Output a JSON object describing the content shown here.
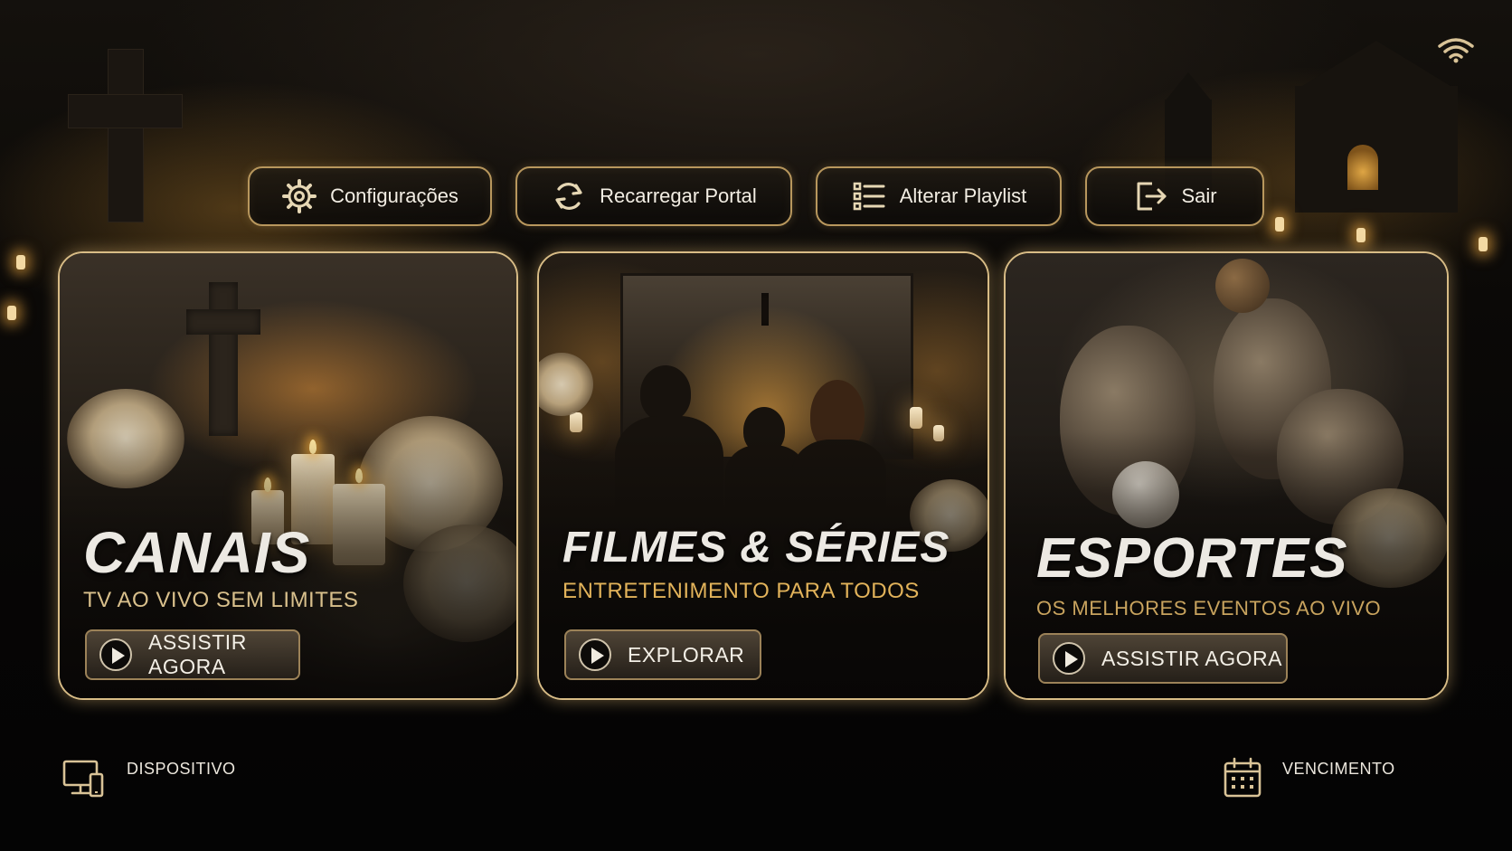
{
  "toolbar": {
    "settings_label": "Configurações",
    "reload_label": "Recarregar Portal",
    "playlist_label": "Alterar Playlist",
    "exit_label": "Sair"
  },
  "cards": [
    {
      "title": "CANAIS",
      "subtitle": "TV AO VIVO SEM LIMITES",
      "button_label": "ASSISTIR AGORA",
      "subtitle_color": "#d9c08c"
    },
    {
      "title": "FILMES & SÉRIES",
      "subtitle": "ENTRETENIMENTO PARA TODOS",
      "button_label": "EXPLORAR",
      "subtitle_color": "#e2b35a"
    },
    {
      "title": "ESPORTES",
      "subtitle": "OS MELHORES EVENTOS AO VIVO",
      "button_label": "ASSISTIR AGORA",
      "subtitle_color": "#c8a35e"
    }
  ],
  "footer": {
    "device_label": "DISPOSITIVO",
    "expiry_label": "VENCIMENTO"
  },
  "colors": {
    "accent_gold": "#d8bc86",
    "background": "#050403"
  },
  "icons": {
    "settings": "gear-icon",
    "reload": "refresh-icon",
    "playlist": "list-icon",
    "exit": "logout-icon",
    "wifi": "wifi-icon",
    "device": "devices-icon",
    "expiry": "calendar-icon",
    "play": "play-icon"
  }
}
